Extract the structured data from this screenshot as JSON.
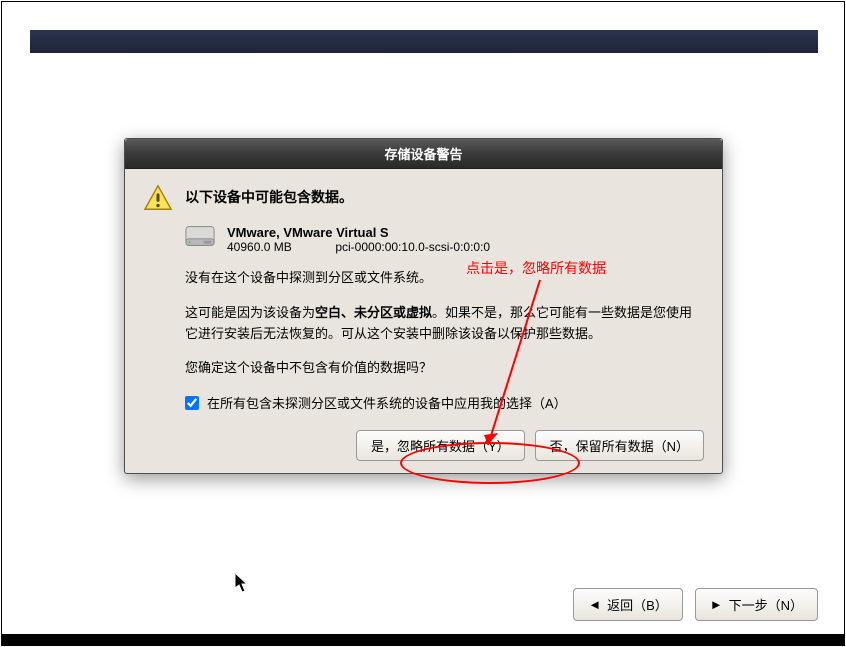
{
  "dialog": {
    "title": "存储设备警告",
    "heading": "以下设备中可能包含数据。",
    "device": {
      "name": "VMware, VMware Virtual S",
      "size": "40960.0 MB",
      "path": "pci-0000:00:10.0-scsi-0:0:0:0"
    },
    "line1": "没有在这个设备中探测到分区或文件系统。",
    "para_pre": "这可能是因为该设备为",
    "para_bold": "空白、未分区或虚拟",
    "para_post": "。如果不是，那么它可能有一些数据是您使用它进行安装后无法恢复的。可从这个安装中删除该设备以保护那些数据。",
    "confirm": "您确定这个设备中不包含有价值的数据吗？",
    "checkbox_label": "在所有包含未探测分区或文件系统的设备中应用我的选择（A）",
    "btn_yes": "是，忽略所有数据（Y）",
    "btn_no": "否，保留所有数据（N）"
  },
  "nav": {
    "back": "返回（B）",
    "next": "下一步（N）"
  },
  "annotation": {
    "hint": "点击是，忽略所有数据"
  }
}
